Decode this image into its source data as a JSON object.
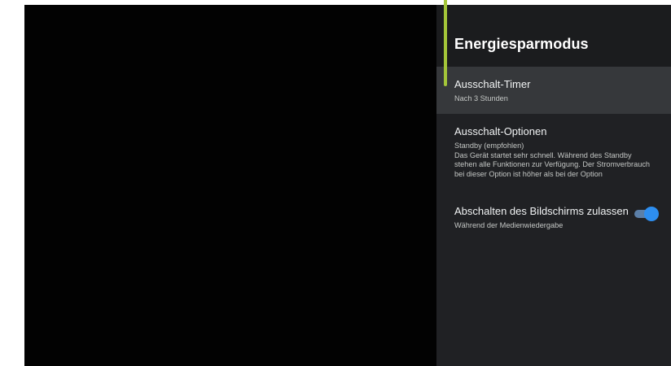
{
  "panel": {
    "title": "Energiesparmodus"
  },
  "items": [
    {
      "title": "Ausschalt-Timer",
      "subtitle": "Nach 3 Stunden"
    },
    {
      "title": "Ausschalt-Optionen",
      "subtitle_lines": [
        "Standby (empfohlen)",
        "Das Gerät startet sehr schnell. Während des Standby",
        "stehen alle Funktionen zur Verfügung. Der Stromverbrauch",
        "bei dieser Option ist höher als bei der Option"
      ]
    },
    {
      "title": "Abschalten des Bildschirms zulassen",
      "subtitle": "Während der Medienwiedergabe",
      "toggle_on": true
    }
  ],
  "colors": {
    "focus_accent": "#a4c639",
    "toggle_thumb": "#2d8ef0",
    "panel_bg": "#202124"
  }
}
